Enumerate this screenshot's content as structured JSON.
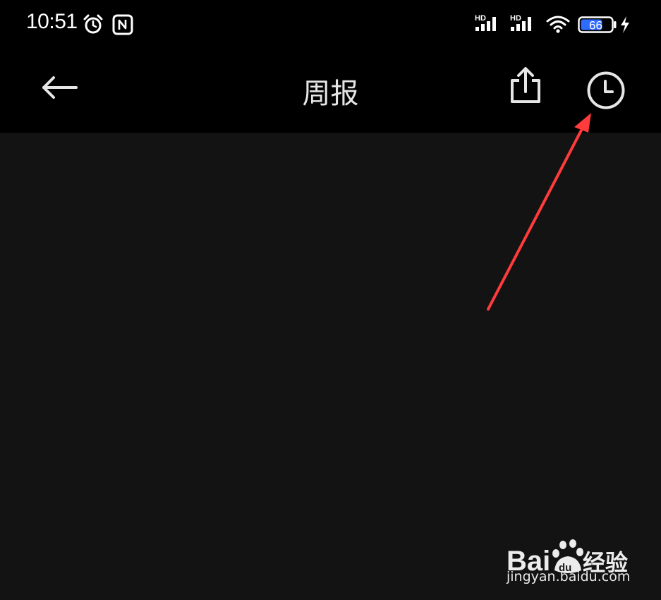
{
  "status_bar": {
    "time": "10:51",
    "icons": [
      "alarm-icon",
      "nfc-icon",
      "signal-hd-icon",
      "signal-hd-icon",
      "wifi-icon",
      "battery-icon",
      "charging-icon"
    ],
    "signal_badge_1": "HD",
    "signal_badge_2": "HD",
    "battery_level": "66",
    "battery_color": "#2f6bff"
  },
  "nav_bar": {
    "title": "周报",
    "back_icon": "arrow-left-icon",
    "share_icon": "share-icon",
    "history_icon": "clock-icon"
  },
  "annotation": {
    "type": "arrow",
    "color": "#ff3b3b",
    "points_to": "history-button"
  },
  "watermark": {
    "brand": "Baidu经验",
    "url": "jingyan.baidu.com"
  }
}
